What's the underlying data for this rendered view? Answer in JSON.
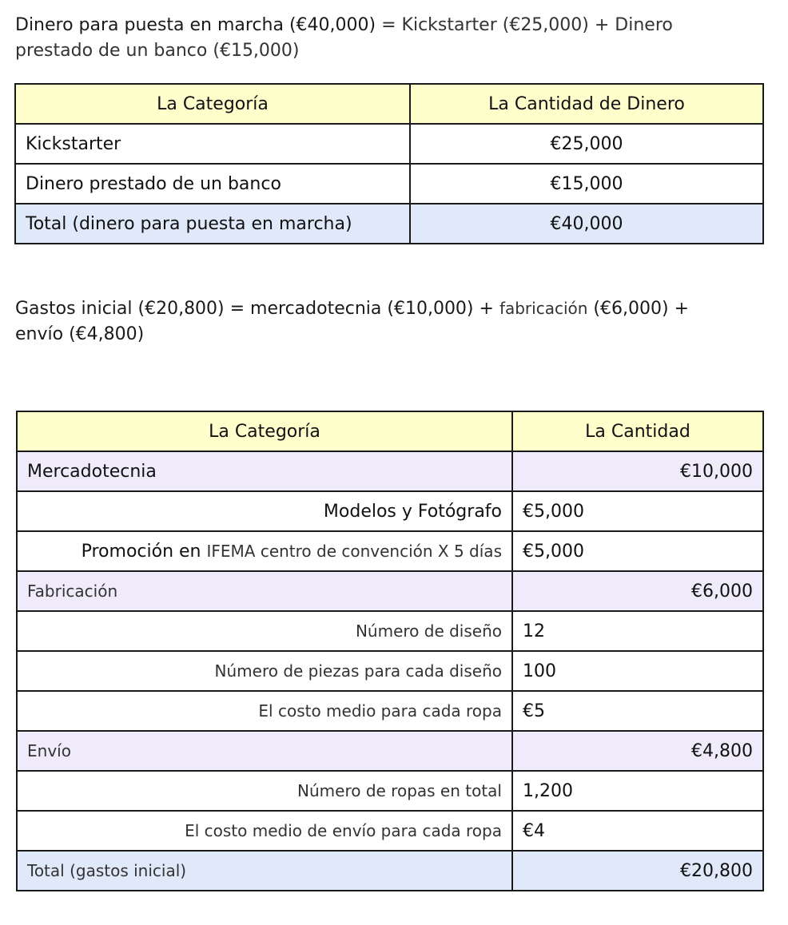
{
  "intro": {
    "line_a": "Dinero para puesta en marcha (€40,000)",
    "line_b": " = Kickstarter (€25,000) + Dinero",
    "line_c": "prestado de un banco (€15,000)"
  },
  "funding_table": {
    "headers": [
      "La Categoría",
      "La Cantidad de Dinero"
    ],
    "rows": [
      {
        "category": "Kickstarter",
        "amount": "€25,000"
      },
      {
        "category": "Dinero prestado de un banco",
        "amount": "€15,000"
      }
    ],
    "total": {
      "category": "Total (dinero para puesta en marcha)",
      "amount": "€40,000"
    }
  },
  "expenses_intro": {
    "line_a": "Gastos inicial (€20,800) = mercadotecnia (€10,000) + ",
    "line_b": "fabricación",
    "line_c": " (€6,000) +",
    "line_d": "envío (€4,800)"
  },
  "expenses_table": {
    "headers": [
      "La Categoría",
      "La Cantidad"
    ],
    "marketing": {
      "label": "Mercadotecnia",
      "amount": "€10,000",
      "items": [
        {
          "label": "Modelos y Fotógrafo",
          "value": "€5,000"
        },
        {
          "label_a": "Promoción en ",
          "label_b": "IFEMA centro de convención X 5 días",
          "value": "€5,000"
        }
      ]
    },
    "manufacturing": {
      "label": "Fabricación",
      "amount": "€6,000",
      "items": [
        {
          "label": "Número de diseño",
          "value": "12"
        },
        {
          "label": "Número de piezas para cada diseño",
          "value": "100"
        },
        {
          "label": "El costo medio para cada ropa",
          "value": "€5"
        }
      ]
    },
    "shipping": {
      "label": "Envío",
      "amount": "€4,800",
      "items": [
        {
          "label": "Número de ropas en total",
          "value": "1,200"
        },
        {
          "label": "El costo medio de envío para cada ropa",
          "value": "€4"
        }
      ]
    },
    "total": {
      "label": "Total (gastos inicial)",
      "amount": "€20,800"
    }
  }
}
